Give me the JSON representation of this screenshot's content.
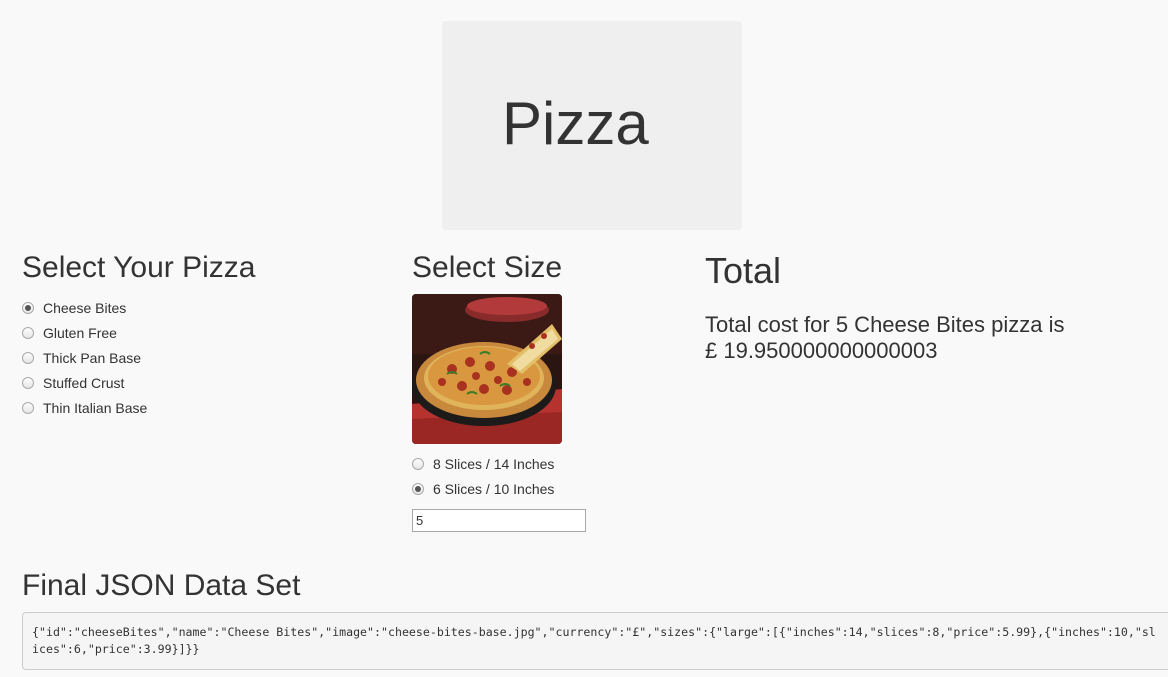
{
  "header": {
    "title": "Pizza"
  },
  "pizza_section": {
    "title": "Select Your Pizza",
    "options": [
      {
        "label": "Cheese Bites",
        "checked": true
      },
      {
        "label": "Gluten Free",
        "checked": false
      },
      {
        "label": "Thick Pan Base",
        "checked": false
      },
      {
        "label": "Stuffed Crust",
        "checked": false
      },
      {
        "label": "Thin Italian Base",
        "checked": false
      }
    ]
  },
  "size_section": {
    "title": "Select Size",
    "options": [
      {
        "label": "8 Slices / 14 Inches",
        "checked": false
      },
      {
        "label": "6 Slices / 10 Inches",
        "checked": true
      }
    ],
    "quantity_value": "5"
  },
  "total_section": {
    "title": "Total",
    "text": "Total cost for 5 Cheese Bites pizza is £ 19.950000000000003"
  },
  "json_section": {
    "title": "Final JSON Data Set",
    "content": "{\"id\":\"cheeseBites\",\"name\":\"Cheese Bites\",\"image\":\"cheese-bites-base.jpg\",\"currency\":\"£\",\"sizes\":{\"large\":[{\"inches\":14,\"slices\":8,\"price\":5.99},{\"inches\":10,\"slices\":6,\"price\":3.99}]}}"
  }
}
